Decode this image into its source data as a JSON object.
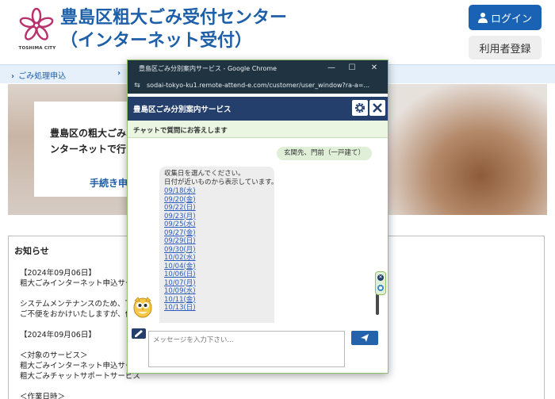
{
  "site": {
    "logo_text": "TOSHIMA CITY",
    "title_line1": "豊島区粗大ごみ受付センター",
    "title_line2": "（インターネット受付）",
    "login_label": "ログイン",
    "register_label": "利用者登録"
  },
  "nav": {
    "items": [
      "ごみ処理申込",
      ""
    ]
  },
  "hero": {
    "text_line1": "豊島区の粗大ごみ収",
    "text_line2": "ンターネットで行う",
    "link_label": "手続き申込"
  },
  "notice": {
    "title": "お知らせ",
    "lines": "【2024年09月06日】\n粗大ごみインターネット申込サー\n\nシステムメンテナンスのため、下\nご不便をおかけいたしますが、何\n\n【2024年09月06日】\n\n＜対象のサービス＞\n粗大ごみインターネット申込サー\n粗大ごみチャットサポートサービス\n\n＜作業日時＞"
  },
  "popup": {
    "window_title": "豊島区ごみ分別案内サービス - Google Chrome",
    "url": "sodai-tokyo-ku1.remote-attend-e.com/customer/user_window?ra-a=...",
    "app_title": "豊島区ごみ分別案内サービス",
    "subtitle": "チャットで質問にお答えします",
    "user_message": "玄関先、門前（一戸建て）",
    "bot_message_line1": "収集日を選んでください。",
    "bot_message_line2": "日付が近いものから表示しています。",
    "dates": [
      "09/18(水)",
      "09/20(金)",
      "09/22(日)",
      "09/23(月)",
      "09/25(水)",
      "09/27(金)",
      "09/29(日)",
      "09/30(月)",
      "10/02(水)",
      "10/04(金)",
      "10/06(日)",
      "10/07(月)",
      "10/09(水)",
      "10/11(金)",
      "10/13(日)"
    ],
    "input_placeholder": "メッセージを入力下さい...",
    "win_controls": [
      "—",
      "☐",
      "✕"
    ]
  },
  "colors": {
    "brand_blue": "#1d5fa8",
    "popup_header": "#243f6b",
    "chat_green": "#e0efd7"
  }
}
